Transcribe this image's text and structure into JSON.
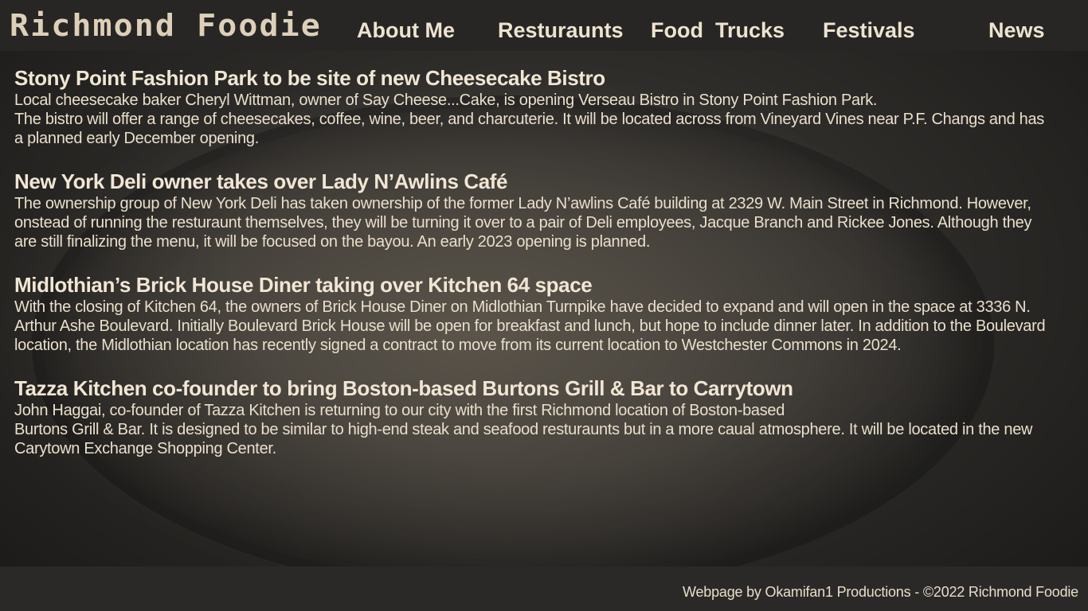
{
  "header": {
    "logo_text": "Richmond Foodie",
    "nav": [
      "About Me",
      "Resturaunts",
      "Food  Trucks",
      "Festivals",
      "News"
    ]
  },
  "articles": [
    {
      "headline": "Stony Point Fashion Park to be site of new Cheesecake Bistro",
      "body": [
        "Local cheesecake baker Cheryl Wittman, owner of Say Cheese...Cake, is opening Verseau Bistro in Stony Point Fashion Park.",
        "The bistro will offer a range of cheesecakes, coffee, wine, beer, and charcuterie. It will be located across from Vineyard Vines near P.F. Changs and has a planned early December opening."
      ]
    },
    {
      "headline": "New York Deli owner takes over Lady N’Awlins Café",
      "body": [
        "The ownership group of New York Deli has taken ownership of the former Lady N’awlins Café building at 2329 W. Main Street in Richmond. However, onstead of running the resturaunt themselves, they will be turning it over to a pair of Deli employees, Jacque Branch and Rickee Jones. Although they are still finalizing the menu, it will be focused on the bayou. An early 2023 opening is planned."
      ]
    },
    {
      "headline": "Midlothian’s Brick House Diner taking over Kitchen 64 space",
      "body": [
        "With the closing of Kitchen 64, the owners of Brick House Diner on Midlothian Turnpike have decided to expand and will open in the space at 3336 N. Arthur Ashe Boulevard. Initially Boulevard Brick House will be open for breakfast and lunch, but hope to include dinner later. In addition to the Boulevard location, the Midlothian location has recently signed a contract to move from its current location to Westchester Commons in 2024."
      ]
    },
    {
      "headline": "Tazza Kitchen co-founder to bring Boston-based Burtons Grill & Bar to Carrytown",
      "body": [
        "John Haggai, co-founder of Tazza Kitchen is returning to our city with the first Richmond location of Boston-based",
        "Burtons Grill & Bar. It is designed to be similar to high-end steak and seafood resturaunts but in a more caual atmosphere. It will be located in the new Carytown Exchange Shopping Center."
      ]
    }
  ],
  "footer": {
    "credit": "Webpage by Okamifan1 Productions - ©2022 Richmond Foodie"
  }
}
